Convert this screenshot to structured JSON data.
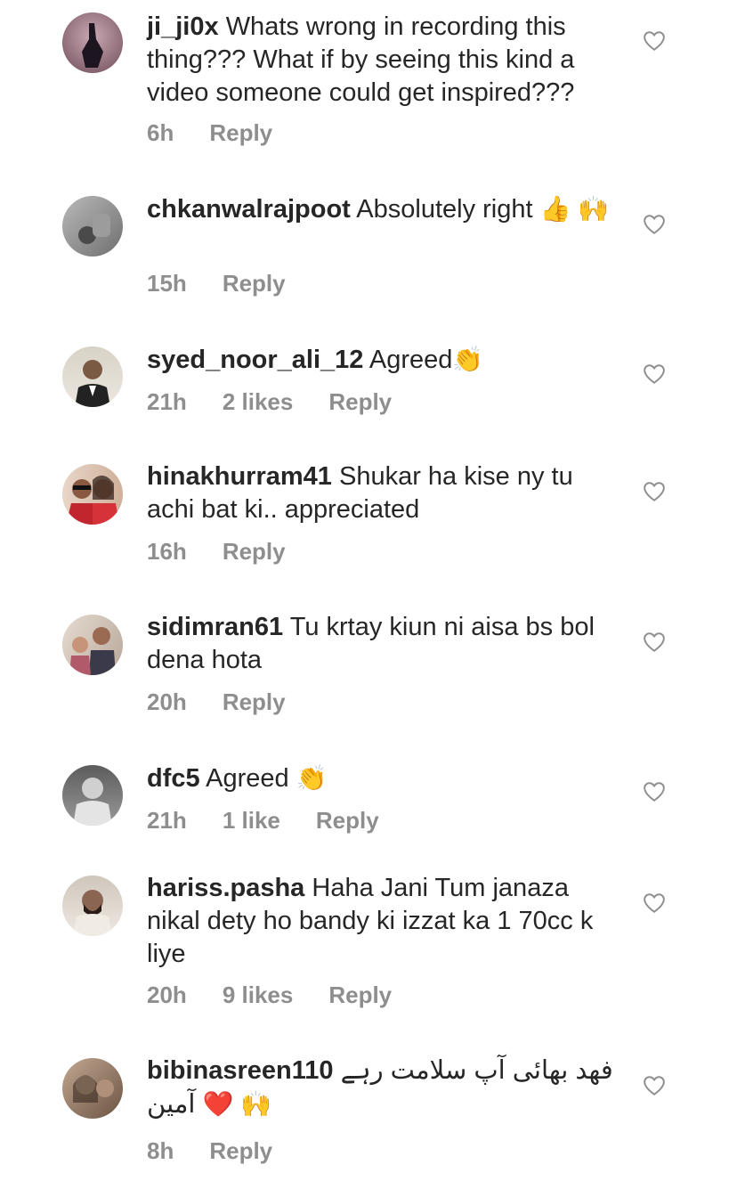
{
  "comments": [
    {
      "username": "ji_ji0x",
      "text": "Whats wrong in recording this thing??? What if by seeing this kind a video someone could get inspired???",
      "time": "6h",
      "likes": "",
      "reply": "Reply",
      "avatar": "dark-silhouette"
    },
    {
      "username": "chkanwalrajpoot",
      "text": "Absolutely right",
      "emoji": "👍 🙌",
      "time": "15h",
      "likes": "",
      "reply": "Reply",
      "avatar": "grey-hand"
    },
    {
      "username": "syed_noor_ali_12",
      "text": "Agreed",
      "emoji": "👏",
      "time": "21h",
      "likes": "2 likes",
      "reply": "Reply",
      "avatar": "person-suit"
    },
    {
      "username": "hinakhurram41",
      "text": "Shukar ha kise ny tu achi bat ki.. appreciated",
      "time": "16h",
      "likes": "",
      "reply": "Reply",
      "avatar": "couple"
    },
    {
      "username": "sidimran61",
      "text": "Tu krtay kiun ni aisa bs bol dena hota",
      "time": "20h",
      "likes": "",
      "reply": "Reply",
      "avatar": "couple-2"
    },
    {
      "username": "dfc5",
      "text": "Agreed",
      "emoji": "👏",
      "time": "21h",
      "likes": "1 like",
      "reply": "Reply",
      "avatar": "vintage-photo"
    },
    {
      "username": "hariss.pasha",
      "text": "Haha Jani Tum janaza nikal dety ho bandy ki izzat ka 1 70cc k liye",
      "time": "20h",
      "likes": "9 likes",
      "reply": "Reply",
      "avatar": "man-beard"
    },
    {
      "username": "bibinasreen110",
      "text": "فھد بھائی آپ سلامت رہے",
      "text2": "آمین",
      "emoji": "❤️ 🙌",
      "time": "8h",
      "likes": "",
      "reply": "Reply",
      "avatar": "woman-sepia"
    }
  ],
  "colors": {
    "text": "#262626",
    "meta": "#8e8e8e",
    "heart_stroke": "#8e8e8e"
  },
  "icons": {
    "like": "heart-outline-icon"
  }
}
